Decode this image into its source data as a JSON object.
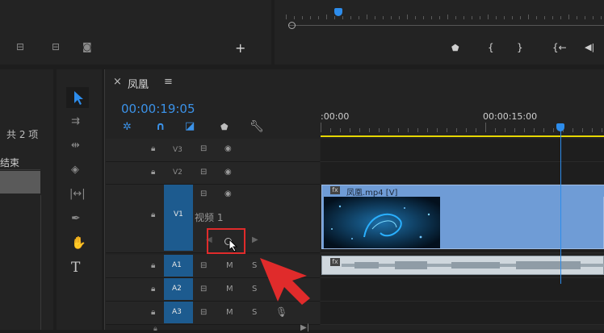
{
  "source_monitor": {
    "add_label": "+"
  },
  "program_monitor": {
    "btn_marker": "⬟",
    "btn_in": "{",
    "btn_out": "}",
    "btn_goto_in": "{←",
    "btn_step_back": "◀|"
  },
  "project": {
    "count_label": "共 2 项",
    "column_end": "结束"
  },
  "sequence": {
    "close": "×",
    "name": "凤凰",
    "menu": "≡",
    "timecode": "00:00:19:05",
    "ruler_start": ":00:00",
    "ruler_mid": "00:00:15:00"
  },
  "tracks": {
    "video": [
      {
        "id": "V3",
        "name": ""
      },
      {
        "id": "V2",
        "name": ""
      },
      {
        "id": "V1",
        "name": "视频 1"
      }
    ],
    "audio": [
      {
        "id": "A1"
      },
      {
        "id": "A2"
      },
      {
        "id": "A3"
      }
    ],
    "mute": "M",
    "solo": "S"
  },
  "clips": {
    "video_label": "凤凰.mp4 [V]",
    "fx": "fx"
  },
  "colors": {
    "accent": "#2d8ceb",
    "workarea": "#e6d600",
    "clip": "#6f9cd6",
    "highlight": "#e02b2b"
  }
}
